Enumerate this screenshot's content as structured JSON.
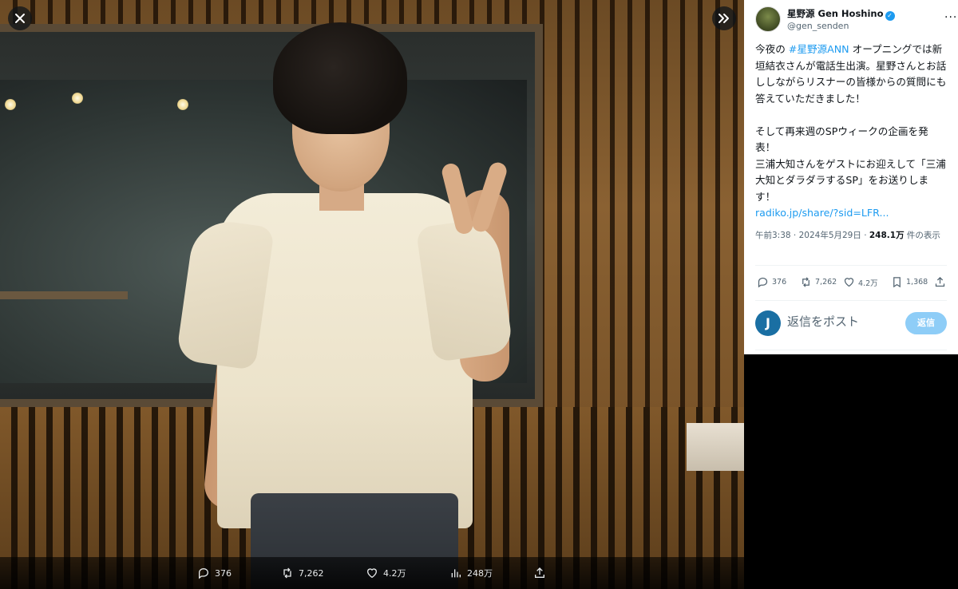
{
  "media": {
    "close_icon": "close-icon",
    "next_icon": "chevron-right-double-icon",
    "bar": {
      "replies": "376",
      "reposts": "7,262",
      "likes": "4.2万",
      "views": "248万"
    }
  },
  "post": {
    "author_name": "星野源 Gen Hoshino",
    "handle": "@gen_senden",
    "more_label": "···",
    "text": {
      "p1_prefix": "今夜の ",
      "p1_hashtag": "#星野源ANN",
      "p1_suffix": " オープニングでは新垣結衣さんが電話生出演。星野さんとお話ししながらリスナーの皆様からの質問にも答えていただきました！",
      "p2": "そして再来週のSPウィークの企画を発表！",
      "p3": "三浦大知さんをゲストにお迎えして「三浦大知とダラダラするSP」をお送りします！",
      "link": "radiko.jp/share/?sid=LFR..."
    },
    "meta": {
      "time": "午前3:38 · 2024年5月29日 · ",
      "views_count": "248.1万",
      "views_label": " 件の表示"
    },
    "actions": {
      "replies": "376",
      "reposts": "7,262",
      "likes": "4.2万",
      "bookmarks": "1,368"
    },
    "reply": {
      "avatar_letter": "J",
      "placeholder": "返信をポスト",
      "button_label": "返信"
    }
  },
  "colors": {
    "accent": "#1d9bf0",
    "reply_button": "#8ecdf7",
    "text_primary": "#0f1419",
    "text_secondary": "#536471"
  }
}
